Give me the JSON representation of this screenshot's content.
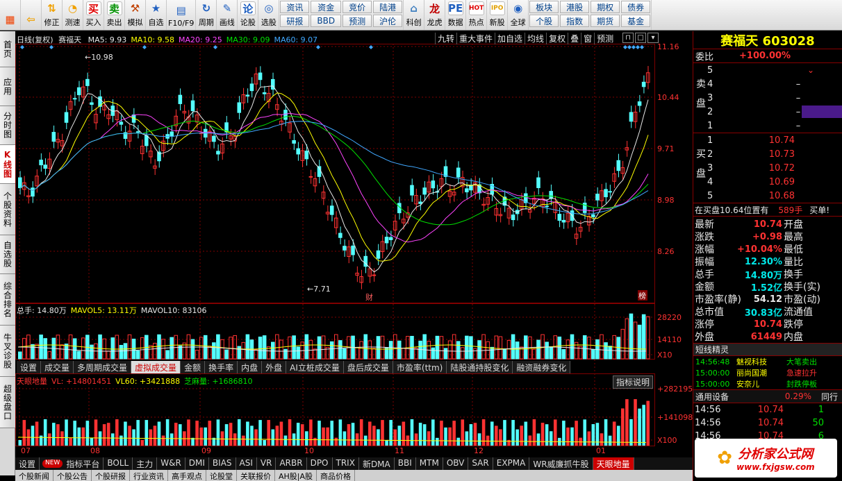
{
  "toolbar": {
    "buttons": [
      {
        "label": "",
        "icon": "windows-logo-icon"
      },
      {
        "label": "",
        "icon": "back-arrow-icon"
      },
      {
        "label": "修正",
        "icon": "up-down-arrow-icon"
      },
      {
        "label": "测速",
        "icon": "speedometer-icon"
      },
      {
        "label": "买入",
        "icon": "buy-icon",
        "glyph": "买"
      },
      {
        "label": "卖出",
        "icon": "sell-icon",
        "glyph": "卖"
      },
      {
        "label": "模拟",
        "icon": "gavel-icon"
      },
      {
        "label": "自选",
        "icon": "star-icon"
      },
      {
        "label": "F10/F9",
        "icon": "f10-icon"
      },
      {
        "label": "周期",
        "icon": "cycle-icon"
      },
      {
        "label": "画线",
        "icon": "pencil-icon"
      },
      {
        "label": "论股",
        "icon": "forum-icon",
        "glyph": "论"
      },
      {
        "label": "选股",
        "icon": "select-stock-icon"
      }
    ],
    "grid1": [
      "资讯",
      "资金",
      "竞价",
      "陆港",
      "研报",
      "BBD",
      "预测",
      "沪伦"
    ],
    "icons2": [
      {
        "label": "科创",
        "icon": "kechuang-icon"
      },
      {
        "label": "龙虎",
        "icon": "dragon-icon"
      },
      {
        "label": "数据",
        "icon": "pe-icon",
        "glyph": "PE"
      },
      {
        "label": "热点",
        "icon": "hot-icon",
        "glyph": "HOT"
      },
      {
        "label": "新股",
        "icon": "ipo-icon",
        "glyph": "IPO"
      },
      {
        "label": "全球",
        "icon": "globe-icon"
      }
    ],
    "grid2": [
      "板块",
      "港股",
      "期权",
      "债券",
      "个股",
      "指数",
      "期货",
      "基金"
    ]
  },
  "side_tabs": [
    "首页",
    "应用",
    "分时图",
    "K线图",
    "个股资料",
    "自选股",
    "综合排名",
    "牛叉诊股",
    "超级盘口"
  ],
  "kline": {
    "header_period": "日线(复权)",
    "stock_name": "赛福天",
    "ma": [
      {
        "label": "MA5: 9.93",
        "color": "#e8e8e8"
      },
      {
        "label": "MA10: 9.58",
        "color": "#ffff00"
      },
      {
        "label": "MA20: 9.25",
        "color": "#ff44ff"
      },
      {
        "label": "MA30: 9.09",
        "color": "#00e000"
      },
      {
        "label": "MA60: 9.07",
        "color": "#40a8ff"
      }
    ],
    "buttons": [
      "九转",
      "重大事件",
      "加自选",
      "均线",
      "复权",
      "叠",
      "窗",
      "预测"
    ],
    "y_ticks": [
      "11.16",
      "10.44",
      "9.71",
      "8.98",
      "8.26"
    ],
    "high_label": "10.98",
    "low_label": "7.71",
    "markers": [
      "财",
      "榜"
    ]
  },
  "volume": {
    "header": [
      {
        "label": "总手: 14.80万",
        "color": "#e8e8e8"
      },
      {
        "label": "MAVOL5: 13.11万",
        "color": "#ffff00"
      },
      {
        "label": "MAVOL10: 83106",
        "color": "#e8e8e8"
      }
    ],
    "y_ticks": [
      "28220",
      "14110",
      "X10"
    ],
    "tabs": [
      "设置",
      "成交量",
      "多周期成交量",
      "虚拟成交量",
      "金额",
      "换手率",
      "内盘",
      "外盘",
      "AI立桩成交量",
      "盘后成交量",
      "市盈率(ttm)",
      "陆股通持股变化",
      "融资融券变化"
    ],
    "active_tab": "虚拟成交量"
  },
  "tianyan": {
    "header": [
      {
        "label": "天眼地量",
        "color": "#ff3232"
      },
      {
        "label": "VL: +14801451",
        "color": "#ff3232"
      },
      {
        "label": "VL60: +3421888",
        "color": "#ffff00"
      },
      {
        "label": "芝麻量: +1686810",
        "color": "#00e000"
      }
    ],
    "explain_button": "指标说明",
    "y_ticks": [
      "+282195",
      "+141098",
      "X100"
    ],
    "x_labels": [
      "07",
      "08",
      "09",
      "10",
      "11",
      "12",
      "01"
    ]
  },
  "indicator_tabs": [
    "设置",
    "NEW",
    "指标平台",
    "BOLL",
    "主力",
    "W&R",
    "DMI",
    "BIAS",
    "ASI",
    "VR",
    "ARBR",
    "DPO",
    "TRIX",
    "新DMA",
    "BBI",
    "MTM",
    "OBV",
    "SAR",
    "EXPMA",
    "WR威廉抓牛股",
    "天眼地量"
  ],
  "news_tabs": [
    "个股新闻",
    "个股公告",
    "个股研报",
    "行业资讯",
    "高手观点",
    "论股堂",
    "关联报价",
    "AH股|A股",
    "商品价格"
  ],
  "panel": {
    "title": "赛福天 603028",
    "weibi_label": "委比",
    "weibi_value": "+100.00%",
    "sell_label": "卖盘",
    "buy_label": "买盘",
    "sell": [
      {
        "n": "5",
        "price": "",
        "vol": ""
      },
      {
        "n": "4",
        "price": "",
        "vol": "–"
      },
      {
        "n": "3",
        "price": "",
        "vol": "–"
      },
      {
        "n": "2",
        "price": "",
        "vol": "–"
      },
      {
        "n": "1",
        "price": "",
        "vol": "–"
      }
    ],
    "buy": [
      {
        "n": "1",
        "price": "10.74"
      },
      {
        "n": "2",
        "price": "10.73"
      },
      {
        "n": "3",
        "price": "10.72"
      },
      {
        "n": "4",
        "price": "10.69"
      },
      {
        "n": "5",
        "price": "10.68"
      }
    ],
    "note": "在买盘10.64位置有",
    "note_vol": "589手",
    "note_tail": "买单!",
    "quote": [
      {
        "l": "最新",
        "v": "10.74",
        "vc": "red",
        "r": "开盘",
        "rv": ""
      },
      {
        "l": "涨跌",
        "v": "+0.98",
        "vc": "red",
        "r": "最高",
        "rv": ""
      },
      {
        "l": "涨幅",
        "v": "+10.04%",
        "vc": "red",
        "r": "最低",
        "rv": ""
      },
      {
        "l": "振幅",
        "v": "12.30%",
        "vc": "cyan",
        "r": "量比",
        "rv": ""
      },
      {
        "l": "总手",
        "v": "14.80万",
        "vc": "cyan",
        "r": "换手",
        "rv": ""
      },
      {
        "l": "金额",
        "v": "1.52亿",
        "vc": "cyan",
        "r": "换手(实)",
        "rv": ""
      },
      {
        "l": "市盈率(静)",
        "v": "54.12",
        "vc": "white",
        "r": "市盈(动)",
        "rv": ""
      },
      {
        "l": "总市值",
        "v": "30.83亿",
        "vc": "cyan",
        "r": "流通值",
        "rv": ""
      },
      {
        "l": "涨停",
        "v": "10.74",
        "vc": "red",
        "r": "跌停",
        "rv": ""
      },
      {
        "l": "外盘",
        "v": "61449",
        "vc": "red",
        "r": "内盘",
        "rv": ""
      }
    ],
    "jingling_title": "短线精灵",
    "jingling": [
      {
        "t": "14:56:48",
        "n": "魅视科技",
        "e": "大笔卖出",
        "ec": "green"
      },
      {
        "t": "15:00:00",
        "n": "丽尚国潮",
        "e": "急速拉升",
        "ec": "red"
      },
      {
        "t": "15:00:00",
        "n": "安奈儿",
        "e": "封跌停板",
        "ec": "green"
      }
    ],
    "tonggong_label": "通用设备",
    "tonggong_pct": "0.29%",
    "tonggong_tail": "同行",
    "ticks": [
      {
        "t": "14:56",
        "p": "10.74",
        "v": "1"
      },
      {
        "t": "14:56",
        "p": "10.74",
        "v": "50"
      },
      {
        "t": "14:56",
        "p": "10.74",
        "v": "6"
      }
    ]
  },
  "logo": {
    "title": "分析家公式网",
    "url": "www.fxjgsw.com"
  },
  "colors": {
    "up": "#ff3232",
    "down": "#54ffff",
    "grid": "#800000",
    "accent": "#ffff00"
  }
}
